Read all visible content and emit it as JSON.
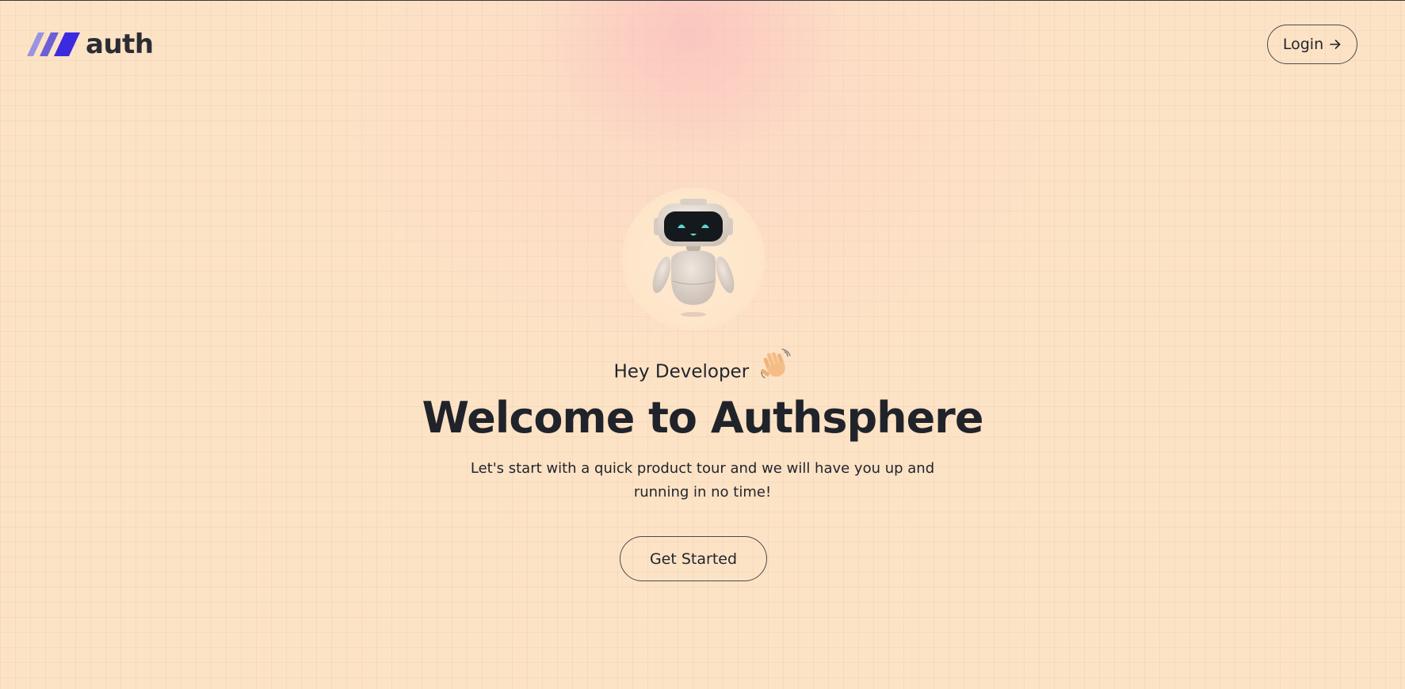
{
  "header": {
    "brand": "auth",
    "logo_icon": "slanted-bars-logo",
    "logo_colors": [
      "#9a93e0",
      "#6c5fd6",
      "#3a2be0"
    ],
    "login_label": "Login",
    "login_icon": "arrow-right-icon"
  },
  "hero": {
    "avatar_icon": "robot-mascot",
    "greeting": "Hey Developer",
    "greeting_icon": "waving-hand-icon",
    "title": "Welcome to Authsphere",
    "subtitle": "Let's start with a quick product tour and we will have you up and running in no time!",
    "cta_label": "Get Started"
  },
  "colors": {
    "background": "#fde3c6",
    "text": "#22252c",
    "glow": "#fabebe"
  }
}
